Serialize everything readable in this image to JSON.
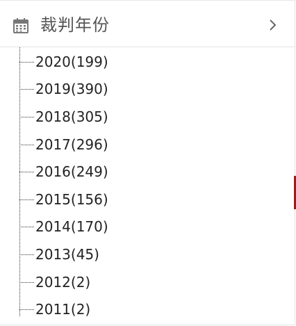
{
  "header": {
    "title": "裁判年份",
    "icon": "calendar-icon",
    "expand_icon": "chevron-right-icon"
  },
  "years": [
    {
      "label": "2020(199)"
    },
    {
      "label": "2019(390)"
    },
    {
      "label": "2018(305)"
    },
    {
      "label": "2017(296)"
    },
    {
      "label": "2016(249)"
    },
    {
      "label": "2015(156)"
    },
    {
      "label": "2014(170)"
    },
    {
      "label": "2013(45)"
    },
    {
      "label": "2012(2)"
    },
    {
      "label": "2011(2)"
    }
  ],
  "colors": {
    "title_text": "#555555",
    "item_text": "#222222",
    "accent_marker": "#a11a1a"
  }
}
